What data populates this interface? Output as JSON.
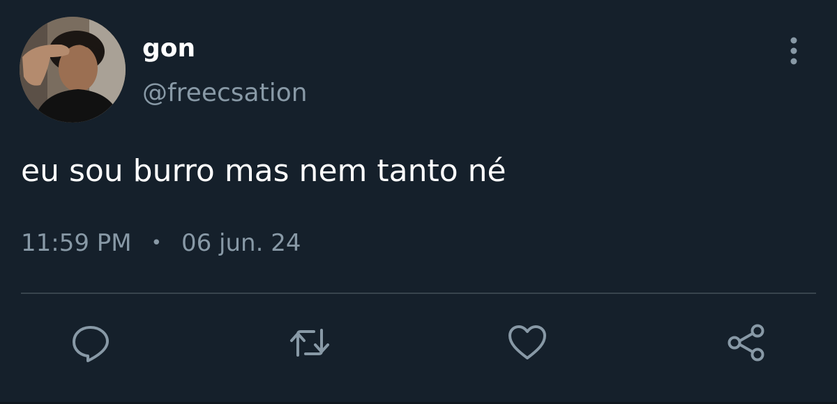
{
  "tweet": {
    "author": {
      "display_name": "gon",
      "handle": "@freecsation"
    },
    "text": "eu sou burro mas nem tanto né",
    "time": "11:59 PM",
    "separator": "•",
    "date": "06 jun. 24"
  },
  "icons": {
    "more": "more-vertical-icon",
    "reply": "reply-icon",
    "retweet": "retweet-icon",
    "like": "heart-icon",
    "share": "share-icon"
  },
  "colors": {
    "background": "#15202b",
    "primary_text": "#ffffff",
    "secondary_text": "#8899a6",
    "divider": "#38444d"
  }
}
